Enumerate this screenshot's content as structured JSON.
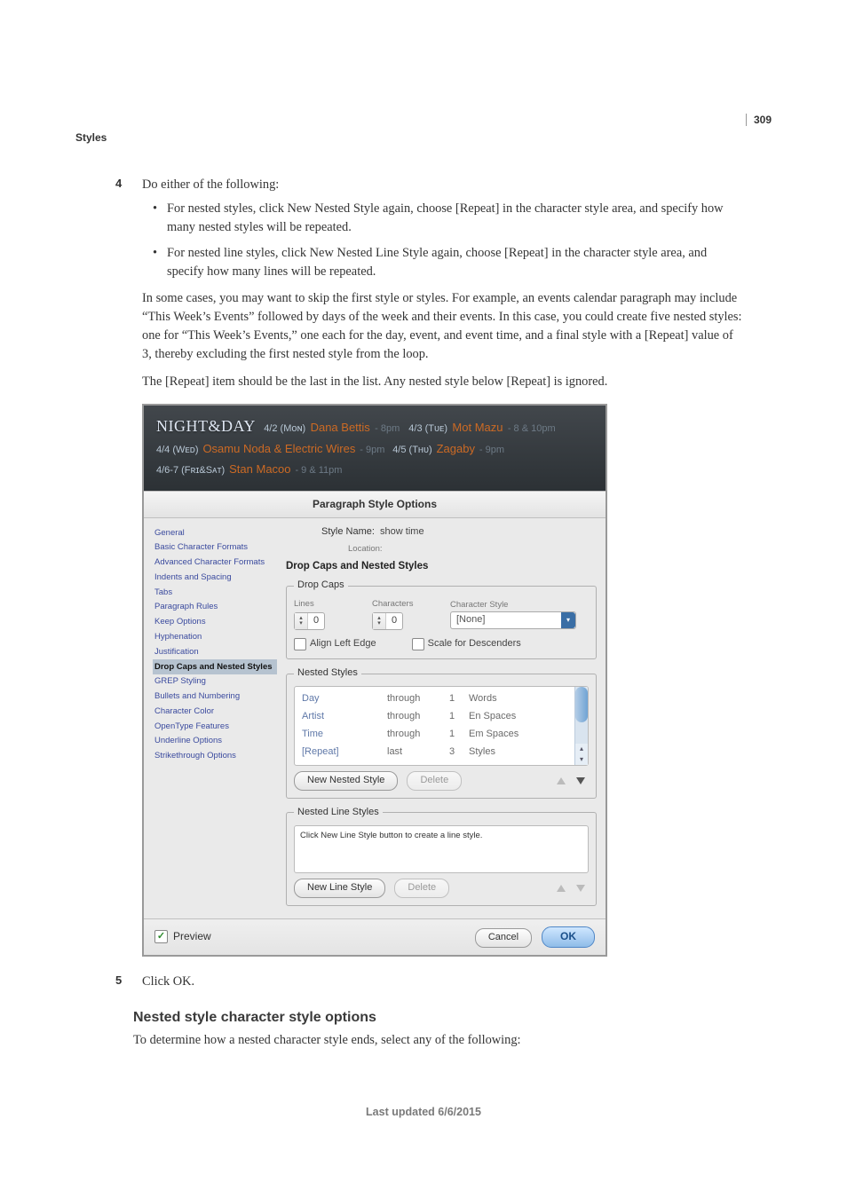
{
  "page_number": "309",
  "chapter": "Styles",
  "step4": {
    "num": "4",
    "intro": "Do either of the following:",
    "bullets": [
      "For nested styles, click New Nested Style again, choose [Repeat] in the character style area, and specify how many nested styles will be repeated.",
      "For nested line styles, click New Nested Line Style again, choose [Repeat] in the character style area, and specify how many lines will be repeated."
    ],
    "para1": "In some cases, you may want to skip the first style or styles. For example, an events calendar paragraph may include “This Week’s Events” followed by days of the week and their events. In this case, you could create five nested styles: one for “This Week’s Events,” one each for the day, event, and event time, and a final style with a [Repeat] value of 3, thereby excluding the first nested style from the loop.",
    "para2": "The [Repeat] item should be the last in the list. Any nested style below [Repeat] is ignored."
  },
  "figure": {
    "nd_title": "NIGHT&DAY",
    "l1_a_date": "4/2 (Mᴏɴ)",
    "l1_a_artist": "Dana Bettis",
    "l1_a_time": "- 8pm",
    "l1_b_date": "4/3 (Tᴜᴇ)",
    "l1_b_artist": "Mot Mazu",
    "l1_b_time": "- 8 & 10pm",
    "l2_a_date": "4/4 (Wᴇᴅ)",
    "l2_a_artist": "Osamu Noda & Electric Wires",
    "l2_a_time": "- 9pm",
    "l2_b_date": "4/5 (Tʜᴜ)",
    "l2_b_artist": "Zagaby",
    "l2_b_time": "- 9pm",
    "l3_a_date": "4/6-7 (Fʀɪ&Sᴀᴛ)",
    "l3_a_artist": "Stan Macoo",
    "l3_a_time": "- 9 & 11pm"
  },
  "dialog": {
    "title": "Paragraph Style Options",
    "sidebar": [
      "General",
      "Basic Character Formats",
      "Advanced Character Formats",
      "Indents and Spacing",
      "Tabs",
      "Paragraph Rules",
      "Keep Options",
      "Hyphenation",
      "Justification",
      "Drop Caps and Nested Styles",
      "GREP Styling",
      "Bullets and Numbering",
      "Character Color",
      "OpenType Features",
      "Underline Options",
      "Strikethrough Options"
    ],
    "sidebar_active_index": 9,
    "style_name_label": "Style Name:",
    "style_name_value": "show time",
    "location_label": "Location:",
    "panel_name": "Drop Caps and Nested Styles",
    "dropcaps": {
      "legend": "Drop Caps",
      "lines_label": "Lines",
      "lines_value": "0",
      "chars_label": "Characters",
      "chars_value": "0",
      "charstyle_label": "Character Style",
      "charstyle_value": "[None]",
      "align_left_edge": "Align Left Edge",
      "scale_descenders": "Scale for Descenders"
    },
    "nested": {
      "legend": "Nested Styles",
      "rows": [
        {
          "c1": "Day",
          "c2": "through",
          "c3": "1",
          "c4": "Words"
        },
        {
          "c1": "Artist",
          "c2": "through",
          "c3": "1",
          "c4": "En Spaces"
        },
        {
          "c1": "Time",
          "c2": "through",
          "c3": "1",
          "c4": "Em Spaces"
        },
        {
          "c1": "[Repeat]",
          "c2": "last",
          "c3": "3",
          "c4": "Styles"
        }
      ],
      "new_btn": "New Nested Style",
      "delete_btn": "Delete"
    },
    "nested_line": {
      "legend": "Nested Line Styles",
      "hint": "Click New Line Style button to create a line style.",
      "new_btn": "New Line Style",
      "delete_btn": "Delete"
    },
    "preview_label": "Preview",
    "cancel": "Cancel",
    "ok": "OK"
  },
  "step5": {
    "num": "5",
    "text": "Click OK."
  },
  "section_heading": "Nested style character style options",
  "section_intro": "To determine how a nested character style ends, select any of the following:",
  "footer": "Last updated 6/6/2015"
}
